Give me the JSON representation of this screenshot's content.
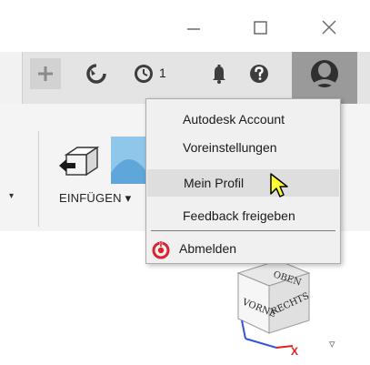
{
  "header": {
    "history_count": "1"
  },
  "ribbon": {
    "insert_label": "EINFÜGEN ▾",
    "left_dropdown": "▾"
  },
  "profile_menu": {
    "items": [
      {
        "label": "Autodesk Account"
      },
      {
        "label": "Voreinstellungen"
      },
      {
        "label": "Mein Profil"
      },
      {
        "label": "Feedback freigeben"
      },
      {
        "label": "Abmelden"
      }
    ],
    "hovered_index": 2
  },
  "viewcube": {
    "faces": [
      "OBEN",
      "VORNE",
      "RECHTS"
    ],
    "axis_label": "X",
    "dropdown": "▿"
  },
  "icons": {
    "minimize": "minimize-icon",
    "maximize": "maximize-icon",
    "close": "close-icon",
    "add_tab": "plus-icon",
    "job_status": "job-status-icon",
    "history": "history-icon",
    "notifications": "bell-icon",
    "help": "help-icon",
    "profile": "avatar",
    "sign_out": "sign-out-icon"
  },
  "colors": {
    "toolbar_bg": "#e4e4e4",
    "avatar_bg": "#9a9a9a",
    "menu_bg": "#f0f0f0",
    "menu_hover": "#dedede",
    "signout_red": "#d9232e",
    "cursor_yellow": "#ffff33"
  }
}
